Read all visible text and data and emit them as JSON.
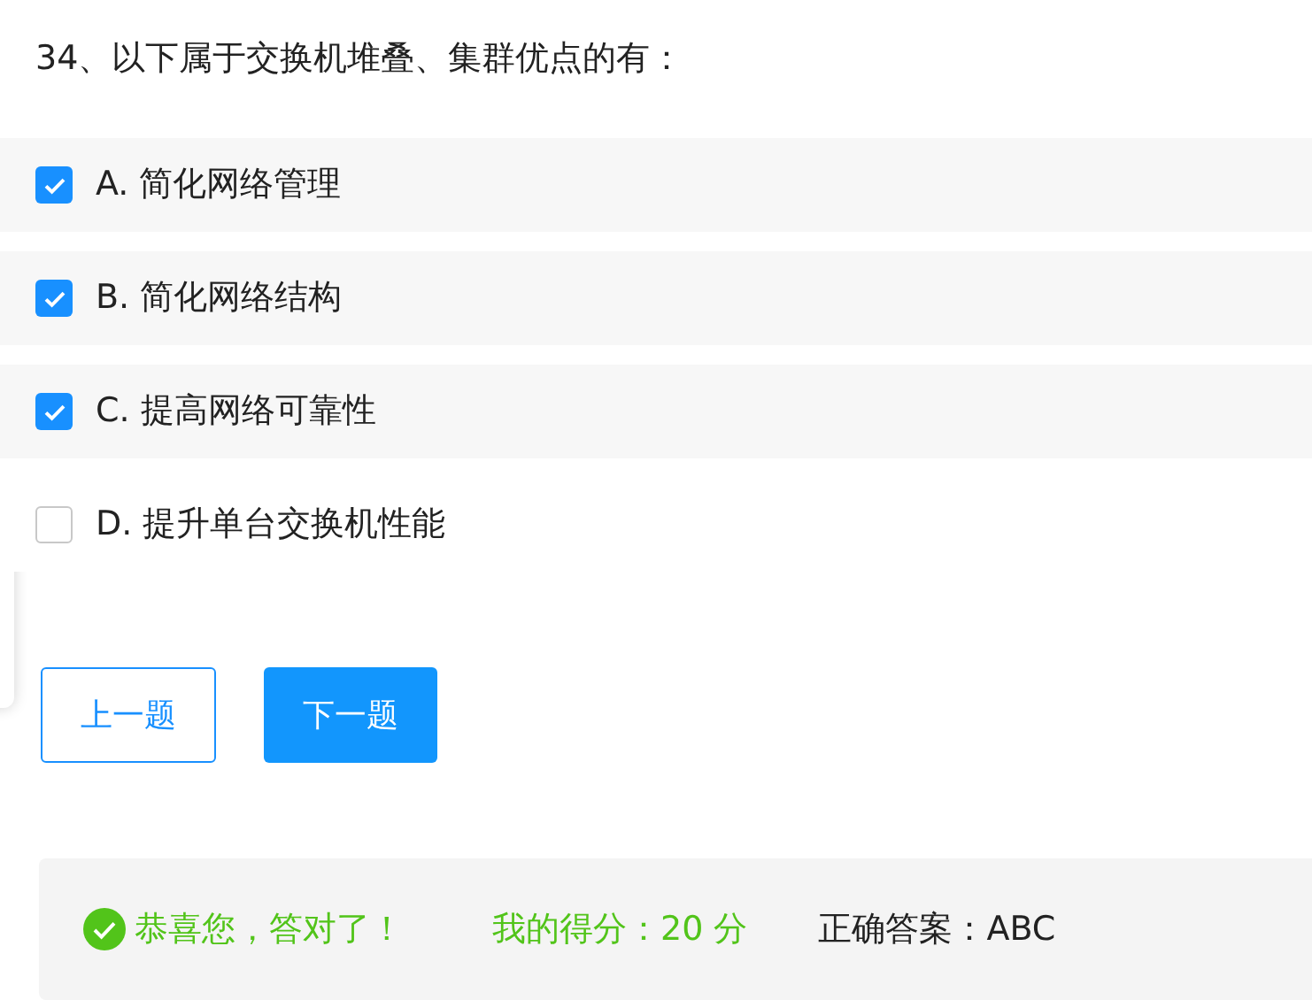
{
  "question": "34、以下属于交换机堆叠、集群优点的有：",
  "options": [
    {
      "label": "A. 简化网络管理",
      "checked": true
    },
    {
      "label": "B. 简化网络结构",
      "checked": true
    },
    {
      "label": "C. 提高网络可靠性",
      "checked": true
    },
    {
      "label": "D. 提升单台交换机性能",
      "checked": false
    }
  ],
  "buttons": [
    {
      "label": "上一题",
      "kind": "outline"
    },
    {
      "label": "下一题",
      "kind": "primary"
    }
  ],
  "result": {
    "message": "恭喜您，答对了！",
    "score": "我的得分：20 分",
    "answer": "正确答案：ABC"
  }
}
